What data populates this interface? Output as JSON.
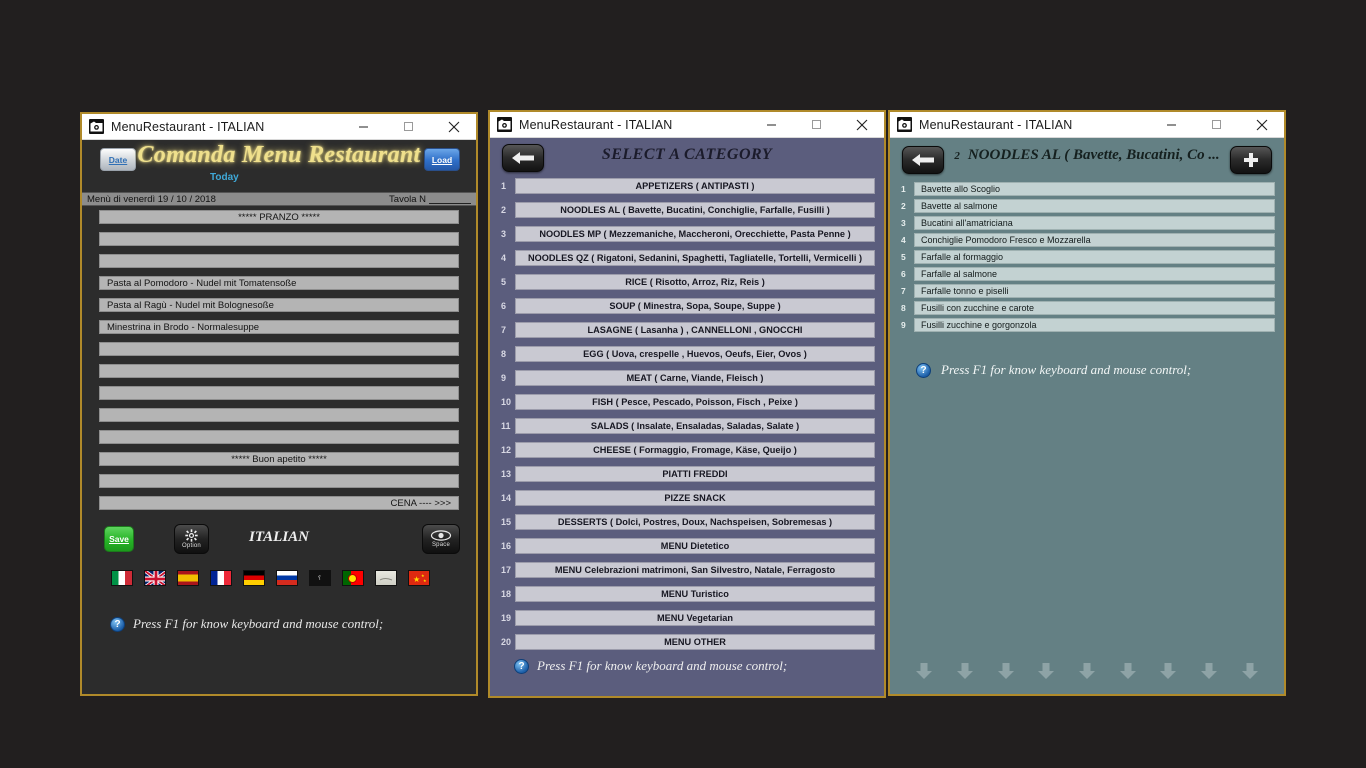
{
  "window1": {
    "title": "MenuRestaurant  -   ITALIAN",
    "date_button": "Date",
    "heading": "Comanda Menu Restaurant",
    "today_label": "Today",
    "load_button": "Load",
    "subbar_left": "Menù di  venerdì  19 / 10 / 2018",
    "subbar_right": "Tavola N",
    "rows": [
      "***** PRANZO *****",
      "",
      "",
      "Pasta al Pomodoro - Nudel mit Tomatensoße",
      "Pasta al Ragù - Nudel mit Bolognesoße",
      "Minestrina in Brodo - Normalesuppe",
      "",
      "",
      "",
      "",
      "",
      "***** Buon apetito  *****",
      "",
      "CENA  ---- >>>"
    ],
    "row_align": [
      "c",
      "l",
      "l",
      "l",
      "l",
      "l",
      "l",
      "l",
      "l",
      "l",
      "l",
      "c",
      "l",
      "r"
    ],
    "save_button": "Save",
    "option_button": "Option",
    "space_button": "Space",
    "language_label": "ITALIAN",
    "flags": [
      {
        "name": "italy",
        "colors": [
          "#009246",
          "#ffffff",
          "#ce2b37"
        ]
      },
      {
        "name": "united-kingdom",
        "colors": [
          "#012169",
          "#ffffff",
          "#c8102e"
        ]
      },
      {
        "name": "spain",
        "colors": [
          "#aa151b",
          "#f1bf00",
          "#aa151b"
        ]
      },
      {
        "name": "france",
        "colors": [
          "#002395",
          "#ffffff",
          "#ed2939"
        ]
      },
      {
        "name": "germany",
        "colors": [
          "#000000",
          "#dd0000",
          "#ffce00"
        ]
      },
      {
        "name": "russia",
        "colors": [
          "#ffffff",
          "#0039a6",
          "#d52b1e"
        ]
      },
      {
        "name": "arabic-black",
        "colors": [
          "#111111",
          "#111111",
          "#111111"
        ]
      },
      {
        "name": "portugal",
        "colors": [
          "#006600",
          "#ff0000",
          "#ffe400"
        ]
      },
      {
        "name": "arabic-white",
        "colors": [
          "#e8e8e0",
          "#e8e8e0",
          "#cfcfc5"
        ]
      },
      {
        "name": "china",
        "colors": [
          "#de2910",
          "#ffde00",
          "#de2910"
        ]
      }
    ],
    "hint": "Press   F1   for know keyboard and mouse control;"
  },
  "window2": {
    "title": "MenuRestaurant  -   ITALIAN",
    "heading": "SELECT A CATEGORY",
    "back_button": "back-arrow",
    "categories": [
      {
        "num": "1",
        "label": "APPETIZERS ( ANTIPASTI  )"
      },
      {
        "num": "2",
        "label": "NOODLES  AL  ( Bavette, Bucatini,  Conchiglie, Farfalle, Fusilli )"
      },
      {
        "num": "3",
        "label": "NOODLES  MP  ( Mezzemaniche, Maccheroni, Orecchiette, Pasta  Penne )"
      },
      {
        "num": "4",
        "label": "NOODLES  QZ  ( Rigatoni, Sedanini, Spaghetti, Tagliatelle, Tortelli, Vermicelli )"
      },
      {
        "num": "5",
        "label": "RICE ( Risotto, Arroz, Riz, Reis )"
      },
      {
        "num": "6",
        "label": "SOUP ( Minestra, Sopa, Soupe,  Suppe )"
      },
      {
        "num": "7",
        "label": "LASAGNE ( Lasanha ) ,  CANNELLONI  ,  GNOCCHI"
      },
      {
        "num": "8",
        "label": "EGG ( Uova, crespelle , Huevos, Oeufs, Eier, Ovos )"
      },
      {
        "num": "9",
        "label": "MEAT   ( Carne, Viande, Fleisch )"
      },
      {
        "num": "10",
        "label": "FISH   ( Pesce, Pescado, Poisson, Fisch , Peixe )"
      },
      {
        "num": "11",
        "label": "SALADS ( Insalate, Ensaladas, Saladas, Salate )"
      },
      {
        "num": "12",
        "label": "CHEESE ( Formaggio, Fromage, Käse, Queijo )"
      },
      {
        "num": "13",
        "label": "PIATTI FREDDI"
      },
      {
        "num": "14",
        "label": "PIZZE  SNACK"
      },
      {
        "num": "15",
        "label": "DESSERTS ( Dolci, Postres, Doux, Nachspeisen, Sobremesas )"
      },
      {
        "num": "16",
        "label": "MENU Dietetico"
      },
      {
        "num": "17",
        "label": "MENU Celebrazioni  matrimoni, San Silvestro, Natale, Ferragosto"
      },
      {
        "num": "18",
        "label": "MENU Turistico"
      },
      {
        "num": "19",
        "label": "MENU Vegetarian"
      },
      {
        "num": "20",
        "label": "MENU OTHER"
      }
    ],
    "hint": "Press   F1   for know keyboard and mouse control;"
  },
  "window3": {
    "title": "MenuRestaurant  -   ITALIAN",
    "heading_index": "2",
    "heading": "NOODLES  AL  ( Bavette, Bucatini, Co ...",
    "back_button": "back-arrow",
    "add_button": "plus",
    "dishes": [
      {
        "num": "1",
        "label": "Bavette allo Scoglio"
      },
      {
        "num": "2",
        "label": "Bavette al salmone"
      },
      {
        "num": "3",
        "label": "Bucatini all'amatriciana"
      },
      {
        "num": "4",
        "label": "Conchiglie Pomodoro Fresco e Mozzarella"
      },
      {
        "num": "5",
        "label": "Farfalle al formaggio"
      },
      {
        "num": "6",
        "label": "Farfalle al salmone"
      },
      {
        "num": "7",
        "label": "Farfalle tonno e piselli"
      },
      {
        "num": "8",
        "label": "Fusilli con zucchine e carote"
      },
      {
        "num": "9",
        "label": "Fusilli zucchine e gorgonzola"
      }
    ],
    "down_buttons_count": 9,
    "hint": "Press   F1   for know keyboard and mouse control;"
  },
  "colors": {
    "window_border": "#b08a2a",
    "desktop": "#221f1f",
    "win1_bg": "#2c2c2c",
    "win2_bg": "#5b5d7d",
    "win3_bg": "#648084",
    "accent_gold": "#efe08c",
    "accent_blue": "#3fa9d8",
    "save_green": "#28b428"
  },
  "titlebar_buttons": {
    "minimize": "–",
    "maximize": "□",
    "close": "✕"
  }
}
